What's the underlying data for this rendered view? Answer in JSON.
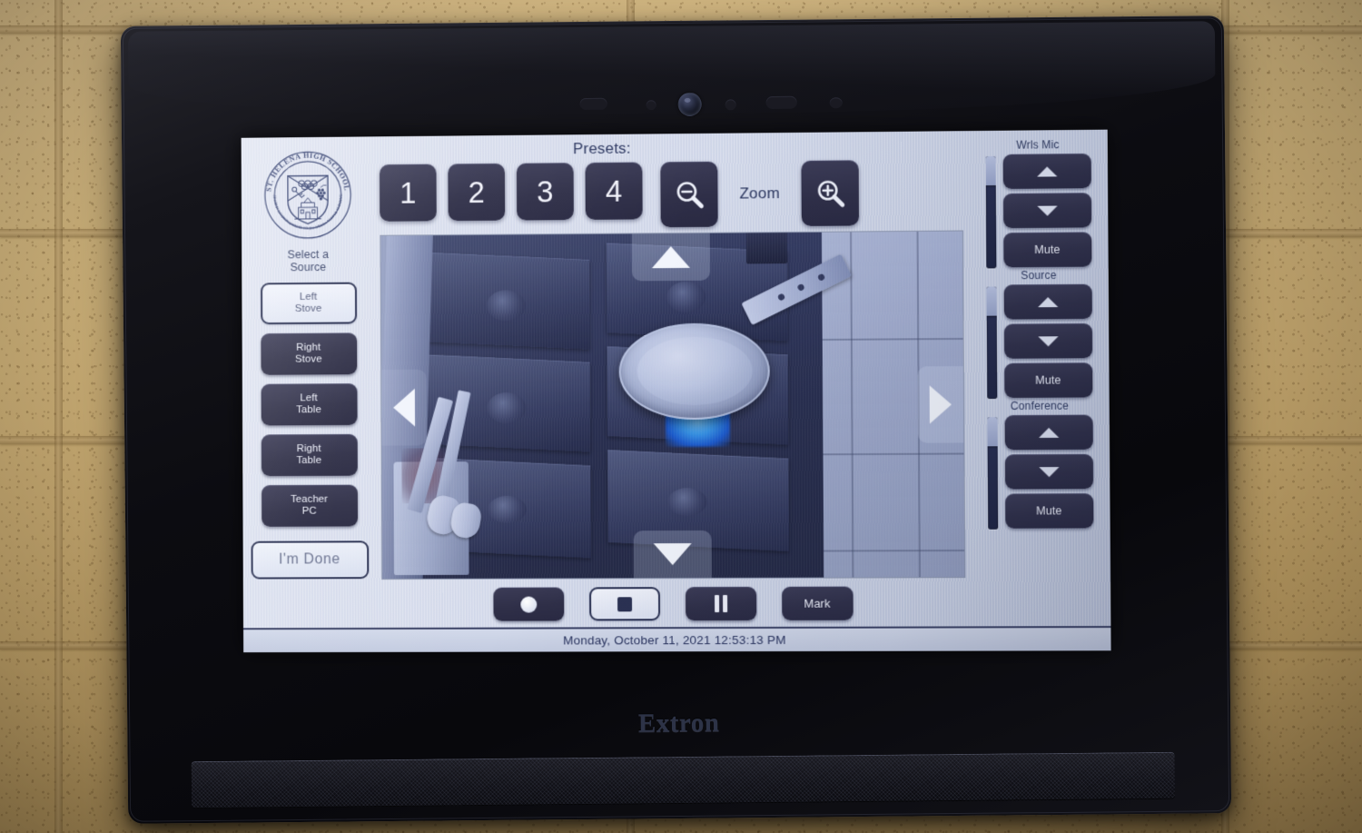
{
  "device": {
    "brand": "Extron",
    "icons": {
      "camera": "camera-lens-icon",
      "speaker": "speaker-grille"
    }
  },
  "screen": {
    "logo": {
      "name": "st-helena-high-school-crest",
      "ring_top": "ST. HELENA HIGH SCHOOL",
      "ring_bottom": "WISDOM IS KNOWING WHAT TO DO NEXT • VIRTUE IS DOING IT"
    },
    "source_panel": {
      "title": "Select a\nSource",
      "title_line1": "Select a",
      "title_line2": "Source",
      "selected": "Left Stove",
      "items": [
        {
          "label": "Left\nStove",
          "line1": "Left",
          "line2": "Stove",
          "active": true
        },
        {
          "label": "Right\nStove",
          "line1": "Right",
          "line2": "Stove",
          "active": false
        },
        {
          "label": "Left\nTable",
          "line1": "Left",
          "line2": "Table",
          "active": false
        },
        {
          "label": "Right\nTable",
          "line1": "Right",
          "line2": "Table",
          "active": false
        },
        {
          "label": "Teacher\nPC",
          "line1": "Teacher",
          "line2": "PC",
          "active": false
        }
      ],
      "done_label": "I'm Done"
    },
    "presets": {
      "title": "Presets:",
      "buttons": [
        "1",
        "2",
        "3",
        "4"
      ]
    },
    "zoom": {
      "label": "Zoom",
      "out_icon": "magnifier-minus-icon",
      "in_icon": "magnifier-plus-icon"
    },
    "video": {
      "description": "Live camera view of a gas stove with a stainless steel frying pan over a lit blue burner flame",
      "pan_controls": [
        {
          "name": "pan-up-arrow",
          "icon": "triangle-up-icon"
        },
        {
          "name": "pan-down-arrow",
          "icon": "triangle-down-icon"
        },
        {
          "name": "pan-left-arrow",
          "icon": "triangle-left-icon"
        },
        {
          "name": "pan-right-arrow",
          "icon": "triangle-right-icon"
        }
      ]
    },
    "transport": [
      {
        "name": "record-button",
        "icon": "record-circle-icon",
        "label": "",
        "style": "filled"
      },
      {
        "name": "stop-button",
        "icon": "stop-square-icon",
        "label": "",
        "style": "outline"
      },
      {
        "name": "pause-button",
        "icon": "pause-bars-icon",
        "label": "",
        "style": "filled"
      },
      {
        "name": "mark-button",
        "icon": "",
        "label": "Mark",
        "style": "filled"
      }
    ],
    "audio_groups": [
      {
        "name": "wireless-mic",
        "label": "Wrls Mic",
        "up": "volume-up-icon",
        "down": "volume-down-icon",
        "mute": "Mute",
        "level": 74
      },
      {
        "name": "source",
        "label": "Source",
        "up": "volume-up-icon",
        "down": "volume-down-icon",
        "mute": "Mute",
        "level": 74
      },
      {
        "name": "conference",
        "label": "Conference",
        "up": "volume-up-icon",
        "down": "volume-down-icon",
        "mute": "Mute",
        "level": 74
      }
    ],
    "status_bar": {
      "datetime": "Monday, October 11, 2021 12:53:13 PM"
    }
  },
  "colors": {
    "button_fill": "#2f2f48",
    "accent_text": "#2c3760",
    "screen_bg": "#d3d9ea",
    "slider_track": "#232a4c"
  }
}
